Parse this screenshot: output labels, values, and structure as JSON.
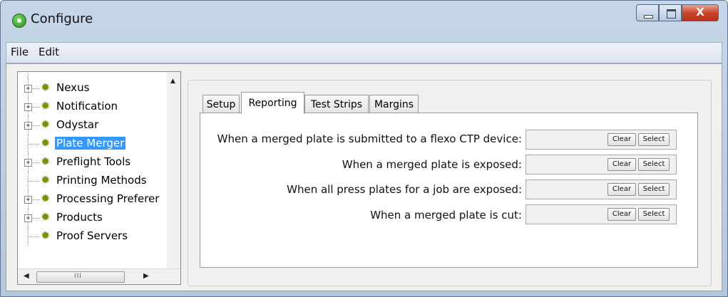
{
  "window": {
    "title": "Configure",
    "controls": {
      "minimize": "",
      "maximize": "",
      "close": "X"
    }
  },
  "menubar": {
    "items": [
      "File",
      "Edit"
    ]
  },
  "tree": {
    "items": [
      {
        "label": "Nexus",
        "expandable": true,
        "selected": false
      },
      {
        "label": "Notification",
        "expandable": true,
        "selected": false
      },
      {
        "label": "Odystar",
        "expandable": true,
        "selected": false
      },
      {
        "label": "Plate Merger",
        "expandable": false,
        "selected": true
      },
      {
        "label": "Preflight Tools",
        "expandable": true,
        "selected": false
      },
      {
        "label": "Printing Methods",
        "expandable": false,
        "selected": false
      },
      {
        "label": "Processing Preferer",
        "expandable": true,
        "selected": false
      },
      {
        "label": "Products",
        "expandable": true,
        "selected": false
      },
      {
        "label": "Proof Servers",
        "expandable": false,
        "selected": false
      }
    ],
    "scroll_thumb_grip": "III",
    "icons": {
      "gear": "gear-icon",
      "expander": "+"
    }
  },
  "tabs": [
    {
      "label": "Setup",
      "active": false
    },
    {
      "label": "Reporting",
      "active": true
    },
    {
      "label": "Test Strips",
      "active": false
    },
    {
      "label": "Margins",
      "active": false
    }
  ],
  "reporting": {
    "rows": [
      {
        "label": "When a merged plate is submitted to a flexo CTP device:",
        "value": "",
        "clear": "Clear",
        "select": "Select"
      },
      {
        "label": "When a merged plate is exposed:",
        "value": "",
        "clear": "Clear",
        "select": "Select"
      },
      {
        "label": "When all press plates for a job are exposed:",
        "value": "",
        "clear": "Clear",
        "select": "Select"
      },
      {
        "label": "When a merged plate is cut:",
        "value": "",
        "clear": "Clear",
        "select": "Select"
      }
    ]
  },
  "colors": {
    "selection": "#3399ff",
    "title_bar": "#c6d6e8",
    "close_button": "#c9462c"
  }
}
